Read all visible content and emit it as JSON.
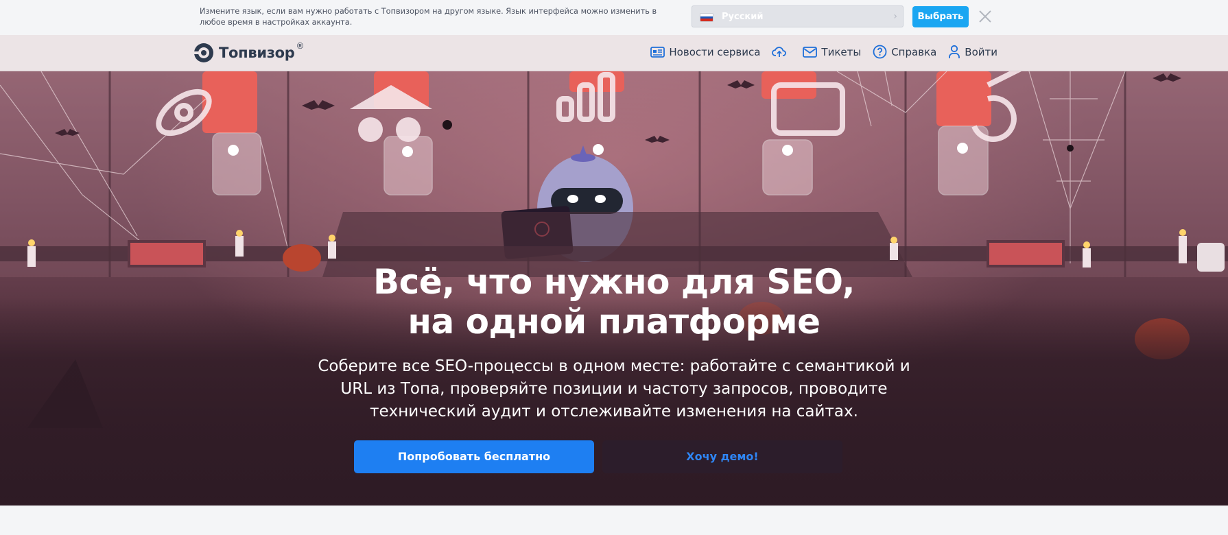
{
  "language_bar": {
    "message": "Измените язык, если вам нужно работать с Топвизором на другом языке. Язык интерфейса можно изменить в любое время в настройках аккаунта.",
    "selected_language": "Русский",
    "choose_label": "Выбрать",
    "flag_colors": [
      "#ffffff",
      "#1c57b8",
      "#d52b1e"
    ]
  },
  "header": {
    "logo_text": "Топвизор",
    "logo_mark": "®",
    "nav": [
      {
        "label": "Новости сервиса",
        "icon": "news-icon"
      },
      {
        "label": "",
        "icon": "cloud-upload-icon"
      },
      {
        "label": "Тикеты",
        "icon": "mail-icon"
      },
      {
        "label": "Справка",
        "icon": "help-circle-icon"
      },
      {
        "label": "Войти",
        "icon": "user-icon"
      }
    ]
  },
  "hero": {
    "title_line1": "Всё, что нужно для SEO,",
    "title_line2": "на одной платформе",
    "subtitle": "Соберите все SEO-процессы в одном месте: работайте с семантикой и URL из Топа, проверяйте позиции и частоту запросов, проводите технический аудит и отслеживайте изменения на сайтах.",
    "primary_button": "Попробовать бесплатно",
    "secondary_button": "Хочу демо!"
  },
  "colors": {
    "accent": "#1e7ff2",
    "choose_button": "#1aa6f2",
    "hero_dark": "#33202a"
  }
}
